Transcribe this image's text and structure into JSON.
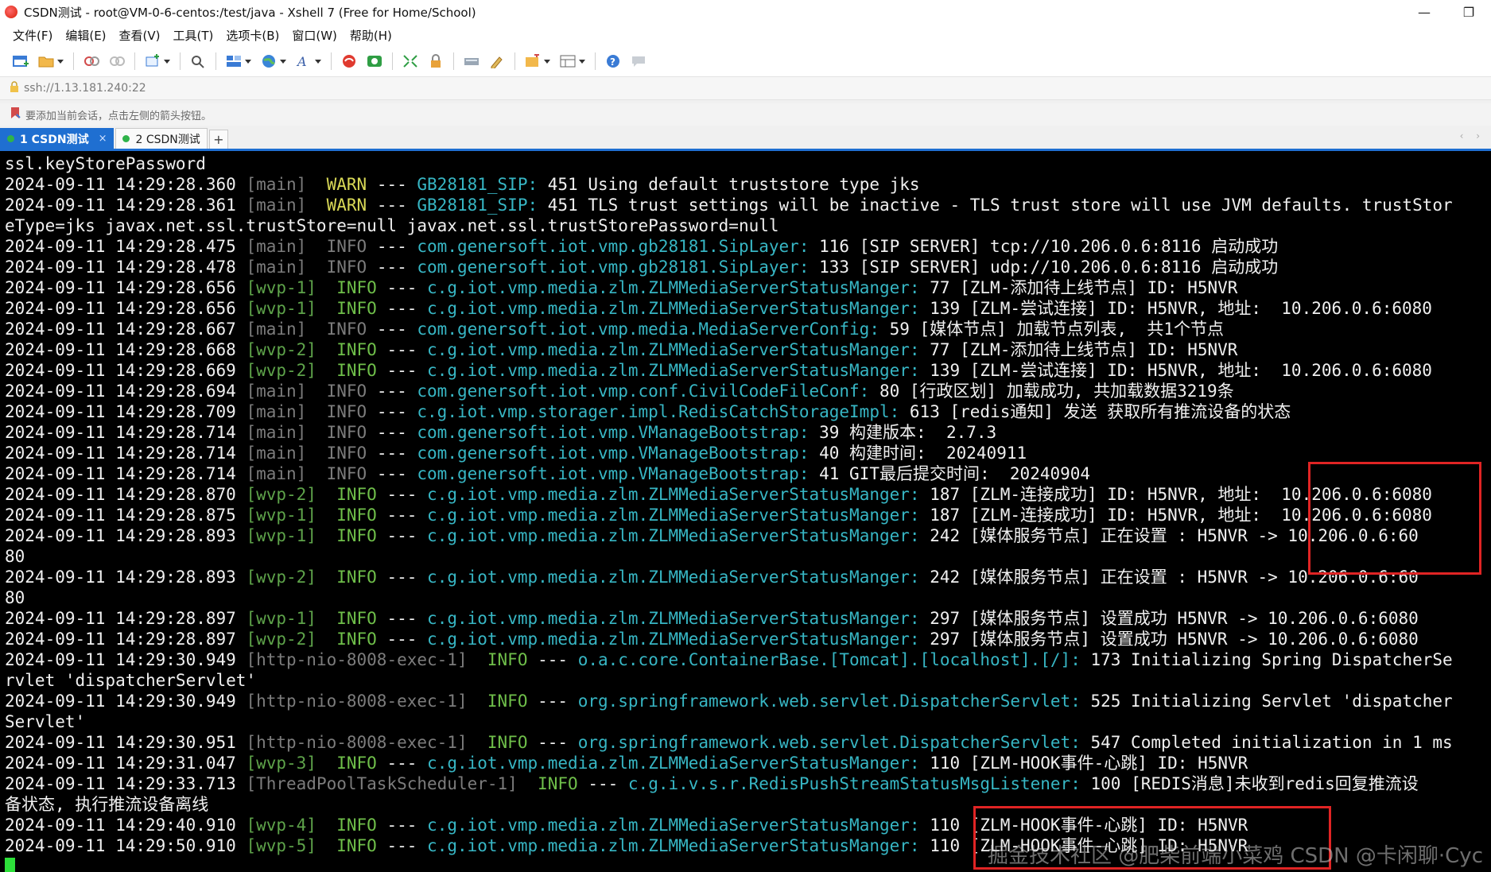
{
  "window": {
    "title": "CSDN测试 - root@VM-0-6-centos:/test/java - Xshell 7 (Free for Home/School)",
    "minimize": "—",
    "maximize": "❐"
  },
  "menu": [
    "文件(F)",
    "编辑(E)",
    "查看(V)",
    "工具(T)",
    "选项卡(B)",
    "窗口(W)",
    "帮助(H)"
  ],
  "toolbar_icons": [
    "new-session-icon",
    "open-folder-icon",
    "reconnect-icon",
    "disconnect-icon",
    "new-tab-icon",
    "find-icon",
    "layout-icon",
    "globe-icon",
    "font-icon",
    "xshell-icon",
    "xftp-icon",
    "fullscreen-icon",
    "lock-icon",
    "keyboard-icon",
    "script-icon",
    "compose-icon",
    "tile-icon",
    "help-icon",
    "comment-icon"
  ],
  "address": "ssh://1.13.181.240:22",
  "hint": "要添加当前会话，点击左侧的箭头按钮。",
  "tabs": [
    {
      "label": "1 CSDN测试",
      "close": "×"
    },
    {
      "label": "2 CSDN测试"
    }
  ],
  "tab_add": "+",
  "tab_scroll": "‹ ›",
  "watermark": "掘金技术社区 @肥柴前端小菜鸡",
  "watermark2": "CSDN @卡闲聊·Cyc",
  "colors": {
    "terminal_bg": "#000000",
    "logger": "#37b6c4",
    "warn": "#d9d957",
    "info": "#6fbf4a",
    "thread": "#7c7c7c",
    "tab_active": "#1f6fd1",
    "highlight_box": "#e02424",
    "cursor": "#2de03a"
  },
  "terminal_lines": [
    {
      "segs": [
        [
          "t",
          "ssl.keyStorePassword"
        ]
      ]
    },
    {
      "segs": [
        [
          "t",
          "2024-09-11 14:29:28.360 "
        ],
        [
          "w",
          "[main]"
        ],
        [
          "t",
          "  "
        ],
        [
          "wl",
          "WARN"
        ],
        [
          "t",
          " --- "
        ],
        [
          "l",
          "GB28181_SIP: "
        ],
        [
          "t",
          "451 Using default truststore type jks"
        ]
      ]
    },
    {
      "segs": [
        [
          "t",
          "2024-09-11 14:29:28.361 "
        ],
        [
          "w",
          "[main]"
        ],
        [
          "t",
          "  "
        ],
        [
          "wl",
          "WARN"
        ],
        [
          "t",
          " --- "
        ],
        [
          "l",
          "GB28181_SIP: "
        ],
        [
          "t",
          "451 TLS trust settings will be inactive - TLS trust store will use JVM defaults. trustStor"
        ]
      ]
    },
    {
      "segs": [
        [
          "t",
          "eType=jks javax.net.ssl.trustStore=null javax.net.ssl.trustStorePassword=null"
        ]
      ]
    },
    {
      "segs": [
        [
          "t",
          "2024-09-11 14:29:28.475 "
        ],
        [
          "th",
          "[main]"
        ],
        [
          "t",
          "  "
        ],
        [
          "id",
          "INFO"
        ],
        [
          "t",
          " --- "
        ],
        [
          "l",
          "com.genersoft.iot.vmp.gb28181.SipLayer: "
        ],
        [
          "t",
          "116 [SIP SERVER] tcp://10.206.0.6:8116 启动成功"
        ]
      ]
    },
    {
      "segs": [
        [
          "t",
          "2024-09-11 14:29:28.478 "
        ],
        [
          "th",
          "[main]"
        ],
        [
          "t",
          "  "
        ],
        [
          "id",
          "INFO"
        ],
        [
          "t",
          " --- "
        ],
        [
          "l",
          "com.genersoft.iot.vmp.gb28181.SipLayer: "
        ],
        [
          "t",
          "133 [SIP SERVER] udp://10.206.0.6:8116 启动成功"
        ]
      ]
    },
    {
      "segs": [
        [
          "t",
          "2024-09-11 14:29:28.656 "
        ],
        [
          "tg",
          "[wvp-1]"
        ],
        [
          "t",
          "  "
        ],
        [
          "i",
          "INFO"
        ],
        [
          "t",
          " --- "
        ],
        [
          "l",
          "c.g.iot.vmp.media.zlm.ZLMMediaServerStatusManger: "
        ],
        [
          "t",
          "77 [ZLM-添加待上线节点] ID: H5NVR"
        ]
      ]
    },
    {
      "segs": [
        [
          "t",
          "2024-09-11 14:29:28.656 "
        ],
        [
          "tg",
          "[wvp-1]"
        ],
        [
          "t",
          "  "
        ],
        [
          "i",
          "INFO"
        ],
        [
          "t",
          " --- "
        ],
        [
          "l",
          "c.g.iot.vmp.media.zlm.ZLMMediaServerStatusManger: "
        ],
        [
          "t",
          "139 [ZLM-尝试连接] ID: H5NVR, 地址:  10.206.0.6:6080"
        ]
      ]
    },
    {
      "segs": [
        [
          "t",
          "2024-09-11 14:29:28.667 "
        ],
        [
          "th",
          "[main]"
        ],
        [
          "t",
          "  "
        ],
        [
          "id",
          "INFO"
        ],
        [
          "t",
          " --- "
        ],
        [
          "l",
          "com.genersoft.iot.vmp.media.MediaServerConfig: "
        ],
        [
          "t",
          "59 [媒体节点] 加载节点列表,  共1个节点"
        ]
      ]
    },
    {
      "segs": [
        [
          "t",
          "2024-09-11 14:29:28.668 "
        ],
        [
          "tg",
          "[wvp-2]"
        ],
        [
          "t",
          "  "
        ],
        [
          "i",
          "INFO"
        ],
        [
          "t",
          " --- "
        ],
        [
          "l",
          "c.g.iot.vmp.media.zlm.ZLMMediaServerStatusManger: "
        ],
        [
          "t",
          "77 [ZLM-添加待上线节点] ID: H5NVR"
        ]
      ]
    },
    {
      "segs": [
        [
          "t",
          "2024-09-11 14:29:28.669 "
        ],
        [
          "tg",
          "[wvp-2]"
        ],
        [
          "t",
          "  "
        ],
        [
          "i",
          "INFO"
        ],
        [
          "t",
          " --- "
        ],
        [
          "l",
          "c.g.iot.vmp.media.zlm.ZLMMediaServerStatusManger: "
        ],
        [
          "t",
          "139 [ZLM-尝试连接] ID: H5NVR, 地址:  10.206.0.6:6080"
        ]
      ]
    },
    {
      "segs": [
        [
          "t",
          "2024-09-11 14:29:28.694 "
        ],
        [
          "th",
          "[main]"
        ],
        [
          "t",
          "  "
        ],
        [
          "id",
          "INFO"
        ],
        [
          "t",
          " --- "
        ],
        [
          "l",
          "com.genersoft.iot.vmp.conf.CivilCodeFileConf: "
        ],
        [
          "t",
          "80 [行政区划] 加载成功, 共加载数据3219条"
        ]
      ]
    },
    {
      "segs": [
        [
          "t",
          "2024-09-11 14:29:28.709 "
        ],
        [
          "th",
          "[main]"
        ],
        [
          "t",
          "  "
        ],
        [
          "id",
          "INFO"
        ],
        [
          "t",
          " --- "
        ],
        [
          "l",
          "c.g.iot.vmp.storager.impl.RedisCatchStorageImpl: "
        ],
        [
          "t",
          "613 [redis通知] 发送 获取所有推流设备的状态"
        ]
      ]
    },
    {
      "segs": [
        [
          "t",
          "2024-09-11 14:29:28.714 "
        ],
        [
          "th",
          "[main]"
        ],
        [
          "t",
          "  "
        ],
        [
          "id",
          "INFO"
        ],
        [
          "t",
          " --- "
        ],
        [
          "l",
          "com.genersoft.iot.vmp.VManageBootstrap: "
        ],
        [
          "t",
          "39 构建版本:  2.7.3"
        ]
      ]
    },
    {
      "segs": [
        [
          "t",
          "2024-09-11 14:29:28.714 "
        ],
        [
          "th",
          "[main]"
        ],
        [
          "t",
          "  "
        ],
        [
          "id",
          "INFO"
        ],
        [
          "t",
          " --- "
        ],
        [
          "l",
          "com.genersoft.iot.vmp.VManageBootstrap: "
        ],
        [
          "t",
          "40 构建时间:  20240911"
        ]
      ]
    },
    {
      "segs": [
        [
          "t",
          "2024-09-11 14:29:28.714 "
        ],
        [
          "th",
          "[main]"
        ],
        [
          "t",
          "  "
        ],
        [
          "id",
          "INFO"
        ],
        [
          "t",
          " --- "
        ],
        [
          "l",
          "com.genersoft.iot.vmp.VManageBootstrap: "
        ],
        [
          "t",
          "41 GIT最后提交时间:  20240904"
        ]
      ]
    },
    {
      "segs": [
        [
          "t",
          "2024-09-11 14:29:28.870 "
        ],
        [
          "tg",
          "[wvp-2]"
        ],
        [
          "t",
          "  "
        ],
        [
          "i",
          "INFO"
        ],
        [
          "t",
          " --- "
        ],
        [
          "l",
          "c.g.iot.vmp.media.zlm.ZLMMediaServerStatusManger: "
        ],
        [
          "t",
          "187 [ZLM-连接成功] ID: H5NVR, 地址:  10.206.0.6:6080"
        ]
      ]
    },
    {
      "segs": [
        [
          "t",
          "2024-09-11 14:29:28.875 "
        ],
        [
          "tg",
          "[wvp-1]"
        ],
        [
          "t",
          "  "
        ],
        [
          "i",
          "INFO"
        ],
        [
          "t",
          " --- "
        ],
        [
          "l",
          "c.g.iot.vmp.media.zlm.ZLMMediaServerStatusManger: "
        ],
        [
          "t",
          "187 [ZLM-连接成功] ID: H5NVR, 地址:  10.206.0.6:6080"
        ]
      ]
    },
    {
      "segs": [
        [
          "t",
          "2024-09-11 14:29:28.893 "
        ],
        [
          "tg",
          "[wvp-1]"
        ],
        [
          "t",
          "  "
        ],
        [
          "i",
          "INFO"
        ],
        [
          "t",
          " --- "
        ],
        [
          "l",
          "c.g.iot.vmp.media.zlm.ZLMMediaServerStatusManger: "
        ],
        [
          "t",
          "242 [媒体服务节点] 正在设置 : H5NVR -> 10.206.0.6:60"
        ]
      ]
    },
    {
      "segs": [
        [
          "t",
          "80"
        ]
      ]
    },
    {
      "segs": [
        [
          "t",
          "2024-09-11 14:29:28.893 "
        ],
        [
          "tg",
          "[wvp-2]"
        ],
        [
          "t",
          "  "
        ],
        [
          "i",
          "INFO"
        ],
        [
          "t",
          " --- "
        ],
        [
          "l",
          "c.g.iot.vmp.media.zlm.ZLMMediaServerStatusManger: "
        ],
        [
          "t",
          "242 [媒体服务节点] 正在设置 : H5NVR -> 10.206.0.6:60"
        ]
      ]
    },
    {
      "segs": [
        [
          "t",
          "80"
        ]
      ]
    },
    {
      "segs": [
        [
          "t",
          "2024-09-11 14:29:28.897 "
        ],
        [
          "tg",
          "[wvp-1]"
        ],
        [
          "t",
          "  "
        ],
        [
          "i",
          "INFO"
        ],
        [
          "t",
          " --- "
        ],
        [
          "l",
          "c.g.iot.vmp.media.zlm.ZLMMediaServerStatusManger: "
        ],
        [
          "t",
          "297 [媒体服务节点] 设置成功 H5NVR -> 10.206.0.6:6080"
        ]
      ]
    },
    {
      "segs": [
        [
          "t",
          "2024-09-11 14:29:28.897 "
        ],
        [
          "tg",
          "[wvp-2]"
        ],
        [
          "t",
          "  "
        ],
        [
          "i",
          "INFO"
        ],
        [
          "t",
          " --- "
        ],
        [
          "l",
          "c.g.iot.vmp.media.zlm.ZLMMediaServerStatusManger: "
        ],
        [
          "t",
          "297 [媒体服务节点] 设置成功 H5NVR -> 10.206.0.6:6080"
        ]
      ]
    },
    {
      "segs": [
        [
          "t",
          "2024-09-11 14:29:30.949 "
        ],
        [
          "th",
          "[http-nio-8008-exec-1]"
        ],
        [
          "t",
          "  "
        ],
        [
          "i",
          "INFO"
        ],
        [
          "t",
          " --- "
        ],
        [
          "l",
          "o.a.c.core.ContainerBase.[Tomcat].[localhost].[/]: "
        ],
        [
          "t",
          "173 Initializing Spring DispatcherSe"
        ]
      ]
    },
    {
      "segs": [
        [
          "t",
          "rvlet 'dispatcherServlet'"
        ]
      ]
    },
    {
      "segs": [
        [
          "t",
          "2024-09-11 14:29:30.949 "
        ],
        [
          "th",
          "[http-nio-8008-exec-1]"
        ],
        [
          "t",
          "  "
        ],
        [
          "i",
          "INFO"
        ],
        [
          "t",
          " --- "
        ],
        [
          "l",
          "org.springframework.web.servlet.DispatcherServlet: "
        ],
        [
          "t",
          "525 Initializing Servlet 'dispatcher"
        ]
      ]
    },
    {
      "segs": [
        [
          "t",
          "Servlet'"
        ]
      ]
    },
    {
      "segs": [
        [
          "t",
          "2024-09-11 14:29:30.951 "
        ],
        [
          "th",
          "[http-nio-8008-exec-1]"
        ],
        [
          "t",
          "  "
        ],
        [
          "i",
          "INFO"
        ],
        [
          "t",
          " --- "
        ],
        [
          "l",
          "org.springframework.web.servlet.DispatcherServlet: "
        ],
        [
          "t",
          "547 Completed initialization in 1 ms"
        ]
      ]
    },
    {
      "segs": [
        [
          "t",
          "2024-09-11 14:29:31.047 "
        ],
        [
          "tg",
          "[wvp-3]"
        ],
        [
          "t",
          "  "
        ],
        [
          "i",
          "INFO"
        ],
        [
          "t",
          " --- "
        ],
        [
          "l",
          "c.g.iot.vmp.media.zlm.ZLMMediaServerStatusManger: "
        ],
        [
          "t",
          "110 [ZLM-HOOK事件-心跳] ID: H5NVR"
        ]
      ]
    },
    {
      "segs": [
        [
          "t",
          "2024-09-11 14:29:33.713 "
        ],
        [
          "th",
          "[ThreadPoolTaskScheduler-1]"
        ],
        [
          "t",
          "  "
        ],
        [
          "i",
          "INFO"
        ],
        [
          "t",
          " --- "
        ],
        [
          "l",
          "c.g.i.v.s.r.RedisPushStreamStatusMsgListener: "
        ],
        [
          "t",
          "100 [REDIS消息]未收到redis回复推流设"
        ]
      ]
    },
    {
      "segs": [
        [
          "t",
          "备状态, 执行推流设备离线"
        ]
      ]
    },
    {
      "segs": [
        [
          "t",
          "2024-09-11 14:29:40.910 "
        ],
        [
          "tg",
          "[wvp-4]"
        ],
        [
          "t",
          "  "
        ],
        [
          "i",
          "INFO"
        ],
        [
          "t",
          " --- "
        ],
        [
          "l",
          "c.g.iot.vmp.media.zlm.ZLMMediaServerStatusManger: "
        ],
        [
          "t",
          "110 [ZLM-HOOK事件-心跳] ID: H5NVR"
        ]
      ]
    },
    {
      "segs": [
        [
          "t",
          "2024-09-11 14:29:50.910 "
        ],
        [
          "tg",
          "[wvp-5]"
        ],
        [
          "t",
          "  "
        ],
        [
          "i",
          "INFO"
        ],
        [
          "t",
          " --- "
        ],
        [
          "l",
          "c.g.iot.vmp.media.zlm.ZLMMediaServerStatusManger: "
        ],
        [
          "t",
          "110 [ZLM-HOOK事件-心跳] ID: H5NVR"
        ]
      ]
    }
  ]
}
